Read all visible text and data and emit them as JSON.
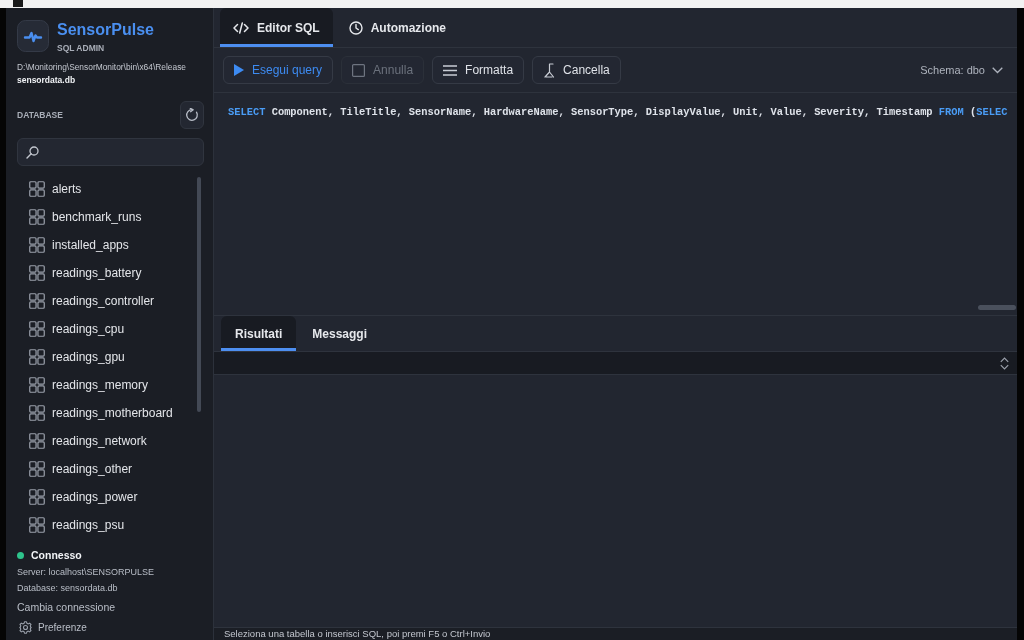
{
  "sidebar": {
    "app_name": "SensorPulse",
    "app_subtitle": "SQL ADMIN",
    "path": "D:\\Monitoring\\SensorMonitor\\bin\\x64\\Release",
    "file": "sensordata.db",
    "section_label": "DATABASE",
    "tables": [
      {
        "name": "alerts",
        "selected": false
      },
      {
        "name": "benchmark_runs",
        "selected": false
      },
      {
        "name": "installed_apps",
        "selected": false
      },
      {
        "name": "readings_battery",
        "selected": false
      },
      {
        "name": "readings_controller",
        "selected": false
      },
      {
        "name": "readings_cpu",
        "selected": false
      },
      {
        "name": "readings_gpu",
        "selected": false
      },
      {
        "name": "readings_memory",
        "selected": false
      },
      {
        "name": "readings_motherboard",
        "selected": false
      },
      {
        "name": "readings_network",
        "selected": false
      },
      {
        "name": "readings_other",
        "selected": false
      },
      {
        "name": "readings_power",
        "selected": false
      },
      {
        "name": "readings_psu",
        "selected": false
      }
    ],
    "connection": {
      "status": "Connesso",
      "connected": true,
      "server": "Server: localhost\\SENSORPULSE",
      "database": "Database: sensordata.db",
      "change_link": "Cambia connessione"
    },
    "preferences": "Preferenze"
  },
  "tabs": [
    {
      "label": "Editor SQL",
      "selected": true
    },
    {
      "label": "Automazione",
      "selected": false
    }
  ],
  "toolbar": {
    "buttons": [
      {
        "label": "Esegui query",
        "kind": "run",
        "disabled": false
      },
      {
        "label": "Annulla",
        "kind": "stop",
        "disabled": true
      },
      {
        "label": "Formatta",
        "kind": "format",
        "disabled": false
      },
      {
        "label": "Cancella",
        "kind": "clear",
        "disabled": false
      }
    ],
    "schema": "Schema: dbo"
  },
  "editor": {
    "tokens": [
      {
        "kind": "keyword",
        "text": "SELECT"
      },
      {
        "kind": "plain",
        "text": " Component, TileTitle, SensorName, HardwareName, SensorType, DisplayValue, Unit, Value, Severity, Timestamp "
      },
      {
        "kind": "keyword",
        "text": "FROM"
      },
      {
        "kind": "plain",
        "text": " ("
      },
      {
        "kind": "keyword",
        "text": "SELEC"
      }
    ]
  },
  "results": {
    "tabs": [
      {
        "label": "Risultati",
        "selected": true
      },
      {
        "label": "Messaggi",
        "selected": false
      }
    ]
  },
  "status_bar": "Seleziona una tabella o inserisci SQL, poi premi F5 o Ctrl+Invio"
}
